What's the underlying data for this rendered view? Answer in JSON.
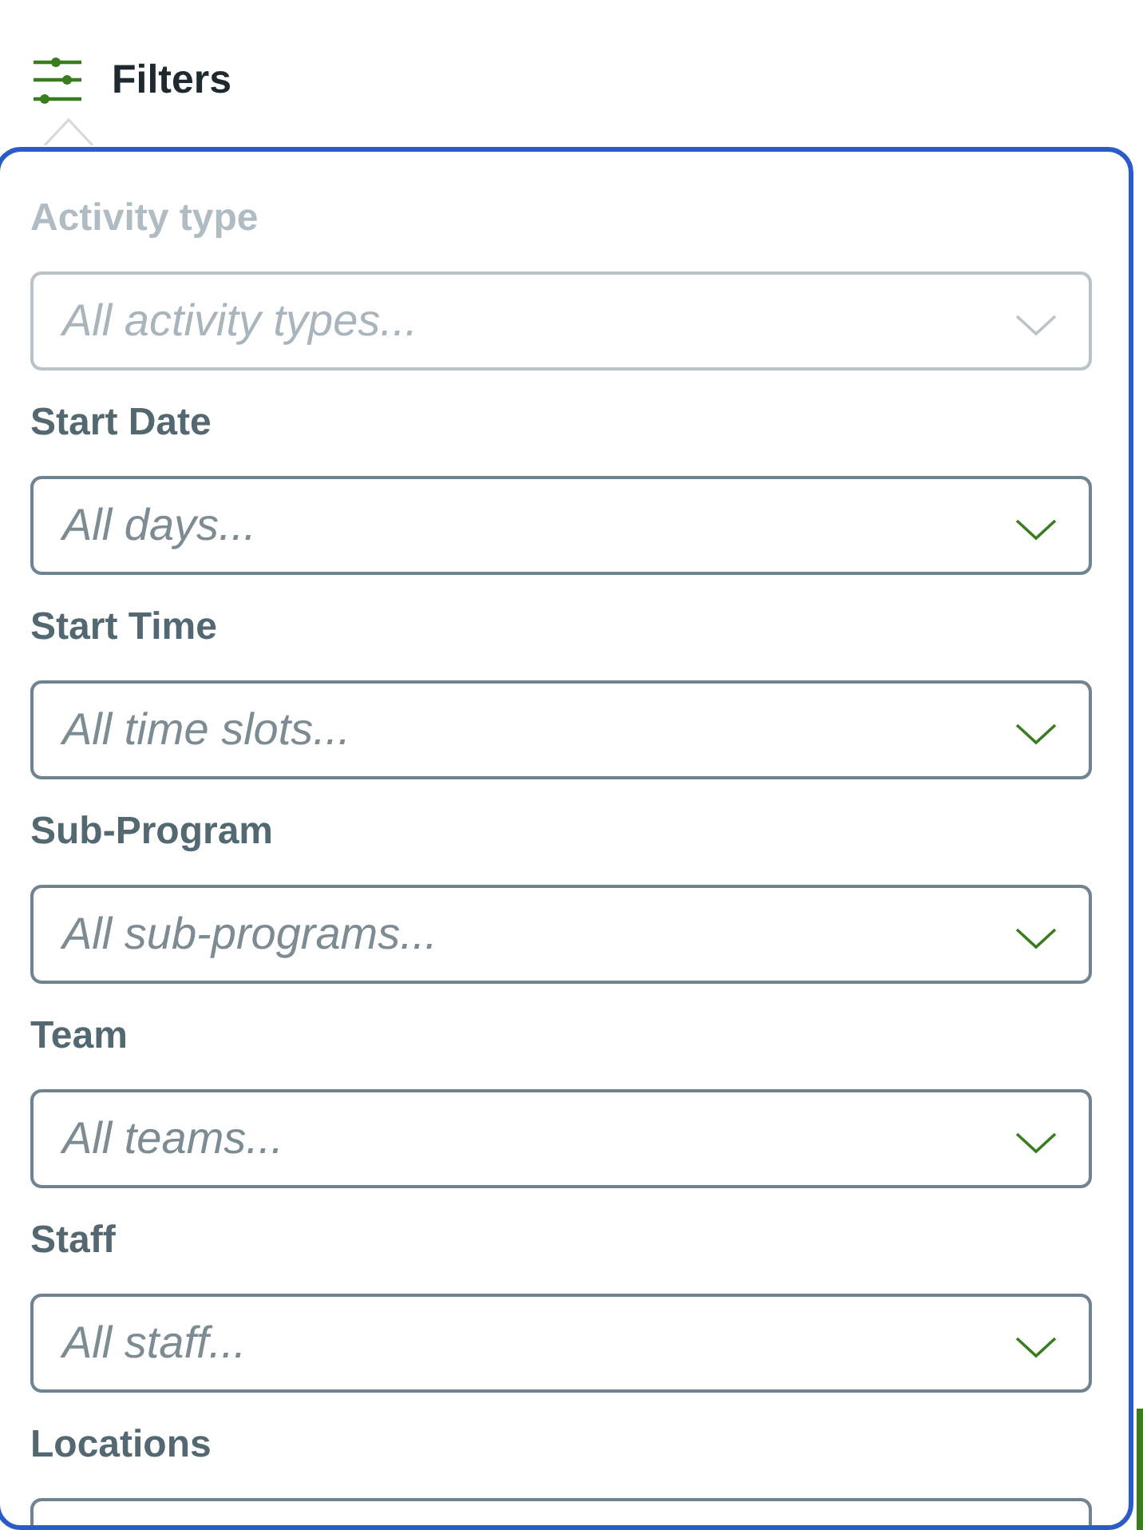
{
  "header": {
    "title": "Filters"
  },
  "filters": [
    {
      "label": "Activity type",
      "placeholder": "All activity types...",
      "disabled": true
    },
    {
      "label": "Start Date",
      "placeholder": "All days...",
      "disabled": false
    },
    {
      "label": "Start Time",
      "placeholder": "All time slots...",
      "disabled": false
    },
    {
      "label": "Sub-Program",
      "placeholder": "All sub-programs...",
      "disabled": false
    },
    {
      "label": "Team",
      "placeholder": "All teams...",
      "disabled": false
    },
    {
      "label": "Staff",
      "placeholder": "All staff...",
      "disabled": false
    },
    {
      "label": "Locations",
      "disabled": false
    }
  ]
}
